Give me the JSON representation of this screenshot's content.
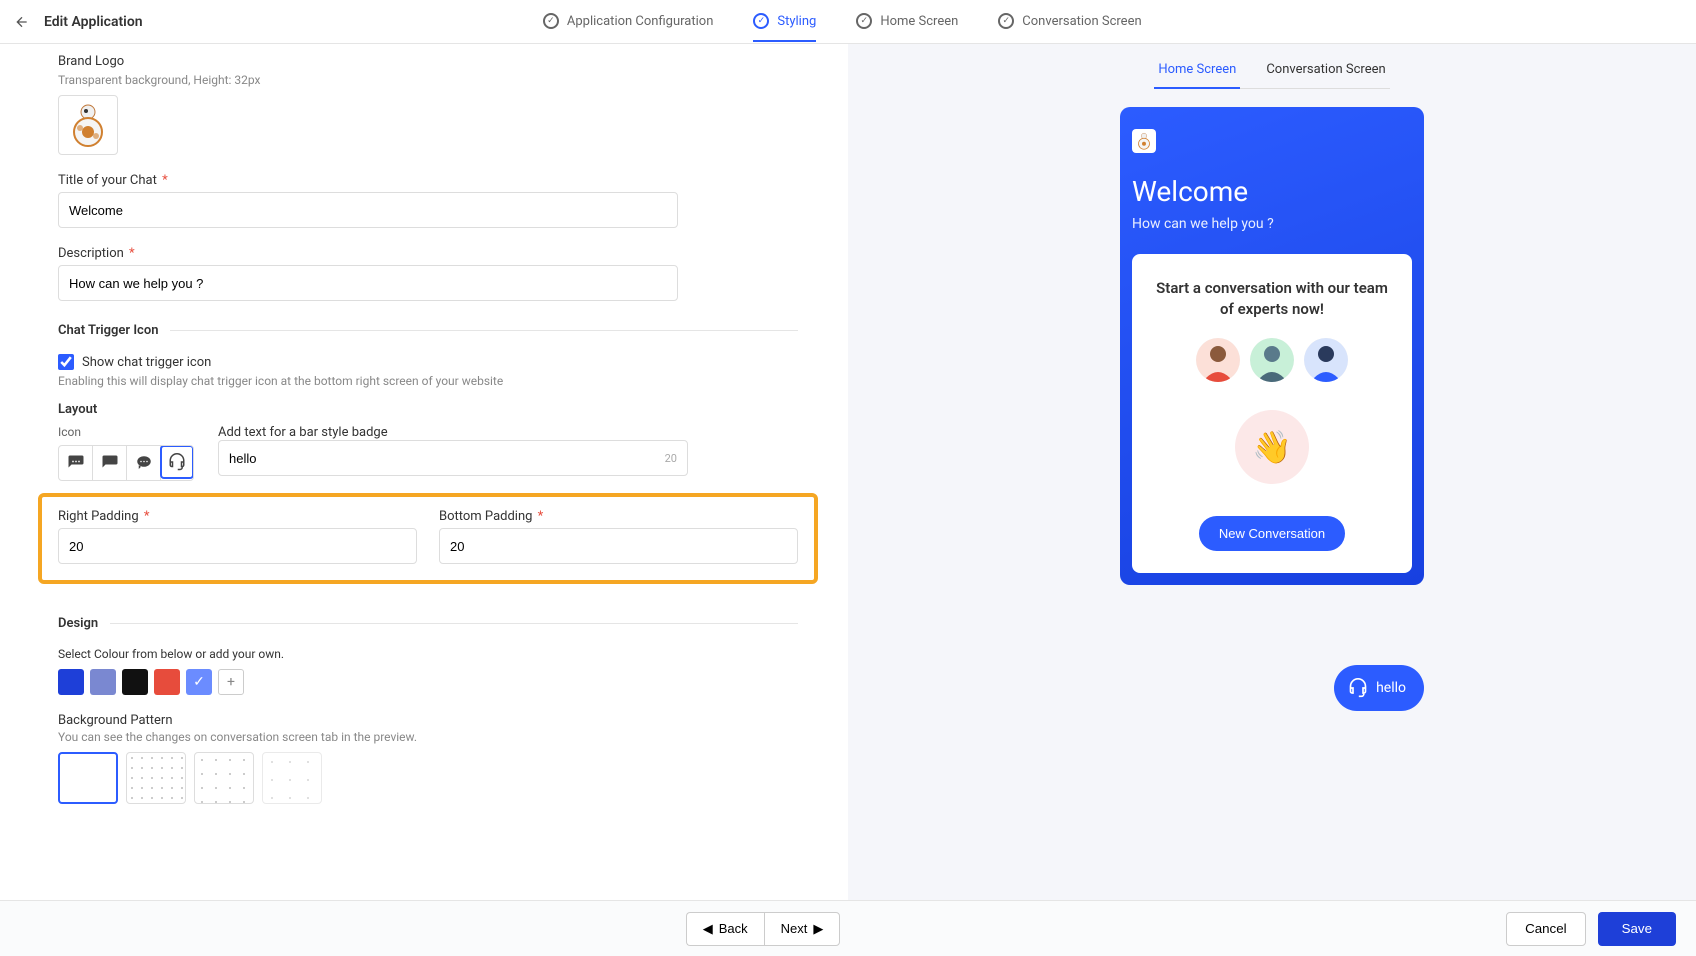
{
  "header": {
    "page_title": "Edit Application",
    "steps": [
      {
        "label": "Application Configuration",
        "active": false
      },
      {
        "label": "Styling",
        "active": true
      },
      {
        "label": "Home Screen",
        "active": false
      },
      {
        "label": "Conversation Screen",
        "active": false
      }
    ]
  },
  "form": {
    "brand_logo": {
      "label": "Brand Logo",
      "hint": "Transparent background, Height: 32px"
    },
    "title_field": {
      "label": "Title of your Chat",
      "value": "Welcome"
    },
    "description_field": {
      "label": "Description",
      "value": "How can we help you ?"
    },
    "trigger_section": "Chat Trigger Icon",
    "show_trigger": {
      "label": "Show chat trigger icon",
      "checked": true
    },
    "trigger_hint": "Enabling this will display chat trigger icon at the bottom right screen of your website",
    "layout_label": "Layout",
    "icon_label": "Icon",
    "badge_label": "Add text for a bar style badge",
    "badge_value": "hello",
    "badge_limit": "20",
    "right_padding": {
      "label": "Right Padding",
      "value": "20"
    },
    "bottom_padding": {
      "label": "Bottom Padding",
      "value": "20"
    },
    "design_section": "Design",
    "color_label": "Select Colour from below or add your own.",
    "colors": [
      {
        "hex": "#1e3fd8",
        "selected": false
      },
      {
        "hex": "#7a88d1",
        "selected": false
      },
      {
        "hex": "#111111",
        "selected": false
      },
      {
        "hex": "#e74c3c",
        "selected": false
      },
      {
        "hex": "#6b8cff",
        "selected": true
      }
    ],
    "pattern_label": "Background Pattern",
    "pattern_hint": "You can see the changes on conversation screen tab in the preview."
  },
  "preview": {
    "tabs": [
      {
        "label": "Home Screen",
        "active": true
      },
      {
        "label": "Conversation Screen",
        "active": false
      }
    ],
    "welcome_title": "Welcome",
    "welcome_subtitle": "How can we help you ?",
    "card_heading": "Start a conversation with our team of experts now!",
    "cta_button": "New Conversation",
    "trigger_text": "hello"
  },
  "footer": {
    "back": "Back",
    "next": "Next",
    "cancel": "Cancel",
    "save": "Save"
  }
}
